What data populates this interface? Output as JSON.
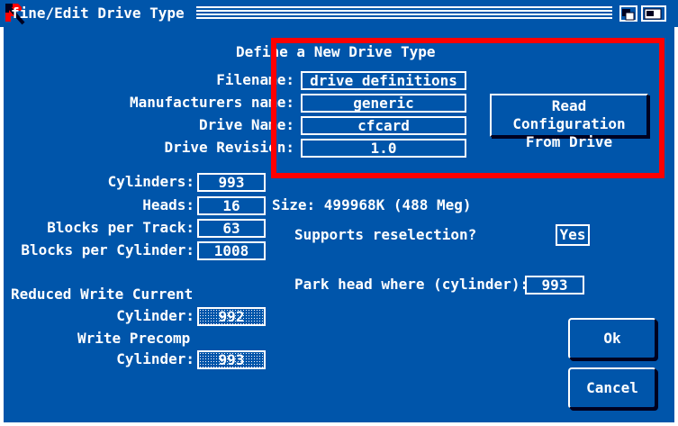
{
  "window": {
    "title": "fine/Edit Drive Type"
  },
  "define": {
    "heading": "Define a New Drive Type",
    "filename_label": "Filename:",
    "filename_value": "drive definitions",
    "manufacturer_label": "Manufacturers name:",
    "manufacturer_value": "generic",
    "drive_name_label": "Drive Name:",
    "drive_name_value": "cfcard",
    "revision_label": "Drive Revision:",
    "revision_value": "1.0",
    "read_button_line1": "Read Configuration",
    "read_button_line2": "From Drive"
  },
  "geometry": {
    "cylinders_label": "Cylinders:",
    "cylinders_value": "993",
    "heads_label": "Heads:",
    "heads_value": "16",
    "blocks_per_track_label": "Blocks per Track:",
    "blocks_per_track_value": "63",
    "blocks_per_cylinder_label": "Blocks per Cylinder:",
    "blocks_per_cylinder_value": "1008",
    "size_text": "Size: 499968K (488 Meg)"
  },
  "options": {
    "reselection_label": "Supports reselection?",
    "reselection_value": "Yes",
    "park_label": "Park head where (cylinder):",
    "park_value": "993"
  },
  "write": {
    "reduced_label": "Reduced Write Current",
    "reduced_cyl_label": "Cylinder:",
    "reduced_cyl_value": "992",
    "precomp_label": "Write Precomp",
    "precomp_cyl_label": "Cylinder:",
    "precomp_cyl_value": "993"
  },
  "buttons": {
    "ok": "Ok",
    "cancel": "Cancel"
  },
  "colors": {
    "background": "#0055aa",
    "foreground": "#ffffff",
    "highlight": "#ff0000",
    "shadow": "#000020"
  }
}
